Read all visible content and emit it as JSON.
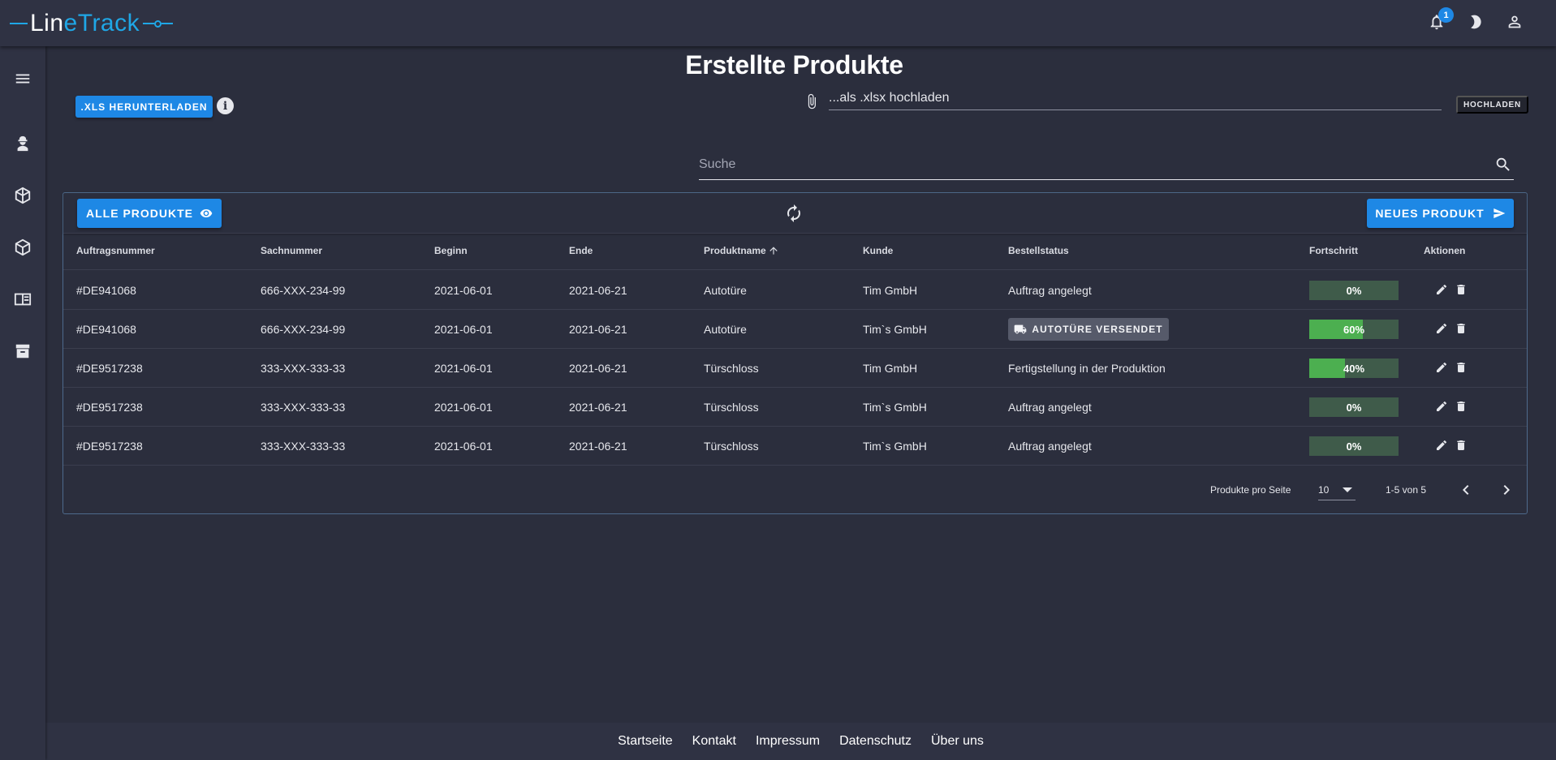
{
  "app": {
    "logo_part1": "Lin",
    "logo_part2": "eTrack",
    "notification_count": "1"
  },
  "page": {
    "title": "Erstellte Produkte"
  },
  "toolbar": {
    "xls_download": ".XLS HERUNTERLADEN",
    "upload_value": "...als .xlsx hochladen",
    "upload_button": "HOCHLADEN",
    "search_placeholder": "Suche"
  },
  "table": {
    "all_products_button": "ALLE PRODUKTE",
    "new_product_button": "NEUES PRODUKT",
    "headers": [
      "Auftragsnummer",
      "Sachnummer",
      "Beginn",
      "Ende",
      "Produktname",
      "Kunde",
      "Bestellstatus",
      "Fortschritt",
      "Aktionen"
    ],
    "rows": [
      {
        "auftrag": "#DE941068",
        "sach": "666-XXX-234-99",
        "beginn": "2021-06-01",
        "ende": "2021-06-21",
        "produkt": "Autotüre",
        "kunde": "Tim GmbH",
        "status": "Auftrag angelegt",
        "progress_label": "0%",
        "progress": 0
      },
      {
        "auftrag": "#DE941068",
        "sach": "666-XXX-234-99",
        "beginn": "2021-06-01",
        "ende": "2021-06-21",
        "produkt": "Autotüre",
        "kunde": "Tim`s GmbH",
        "status": "AUTOTÜRE VERSENDET",
        "progress_label": "60%",
        "progress": 60
      },
      {
        "auftrag": "#DE9517238",
        "sach": "333-XXX-333-33",
        "beginn": "2021-06-01",
        "ende": "2021-06-21",
        "produkt": "Türschloss",
        "kunde": "Tim GmbH",
        "status": "Fertigstellung in der Produktion",
        "progress_label": "40%",
        "progress": 40
      },
      {
        "auftrag": "#DE9517238",
        "sach": "333-XXX-333-33",
        "beginn": "2021-06-01",
        "ende": "2021-06-21",
        "produkt": "Türschloss",
        "kunde": "Tim`s GmbH",
        "status": "Auftrag angelegt",
        "progress_label": "0%",
        "progress": 0
      },
      {
        "auftrag": "#DE9517238",
        "sach": "333-XXX-333-33",
        "beginn": "2021-06-01",
        "ende": "2021-06-21",
        "produkt": "Türschloss",
        "kunde": "Tim`s GmbH",
        "status": "Auftrag angelegt",
        "progress_label": "0%",
        "progress": 0
      }
    ]
  },
  "pagination": {
    "label": "Produkte pro Seite",
    "per_page": "10",
    "range": "1-5 von 5"
  },
  "footer": {
    "links": [
      "Startseite",
      "Kontakt",
      "Impressum",
      "Datenschutz",
      "Über uns"
    ]
  },
  "colors": {
    "accent": "#1e88e5",
    "logo_blue": "#1fa7e6",
    "progress_fill": "#4caf50",
    "progress_track": "#3f5b4a",
    "background": "#2b2e3d"
  }
}
